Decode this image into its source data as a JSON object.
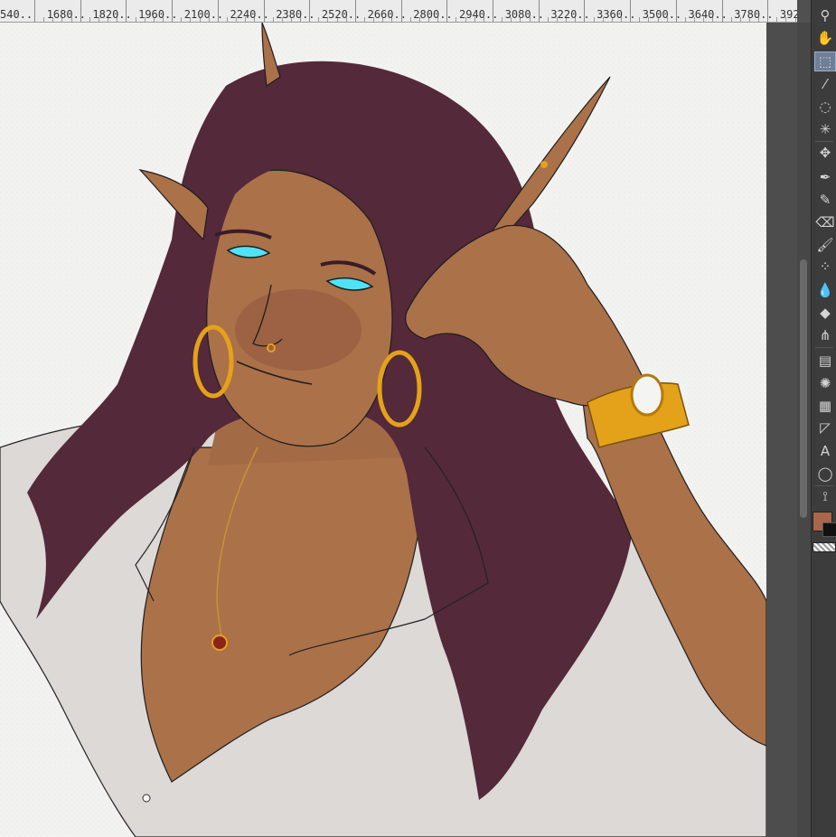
{
  "ruler": {
    "ticks": [
      "540",
      "1680",
      "1820",
      "1960",
      "2100",
      "2240",
      "2380",
      "2520",
      "2660",
      "2800",
      "2940",
      "3080",
      "3220",
      "3360",
      "3500",
      "3640",
      "3780",
      "392"
    ]
  },
  "tools": [
    {
      "name": "zoom-tool",
      "icon": "magnifier-icon",
      "glyph": "⚲"
    },
    {
      "name": "move-hand-tool",
      "icon": "hand-icon",
      "glyph": "✋"
    },
    {
      "name": "operation-tool",
      "icon": "object-select-icon",
      "glyph": "⬚",
      "active": true
    },
    {
      "name": "eyedropper-tool",
      "icon": "eyedropper-icon",
      "glyph": "⁄"
    },
    {
      "name": "lasso-tool",
      "icon": "lasso-icon",
      "glyph": "◌"
    },
    {
      "name": "magic-wand-tool",
      "icon": "magic-wand-icon",
      "glyph": "✳"
    },
    {
      "name": "move-layer-tool",
      "icon": "move-arrows-icon",
      "glyph": "✥"
    },
    {
      "name": "pen-tool",
      "icon": "pen-nib-icon",
      "glyph": "✒"
    },
    {
      "name": "pencil-tool",
      "icon": "pencil-icon",
      "glyph": "✎"
    },
    {
      "name": "eraser-tool",
      "icon": "eraser-icon",
      "glyph": "⌫"
    },
    {
      "name": "brush-tool",
      "icon": "brush-icon",
      "glyph": "🖌"
    },
    {
      "name": "airbrush-tool",
      "icon": "airbrush-icon",
      "glyph": "⁘"
    },
    {
      "name": "blend-tool",
      "icon": "blend-drops-icon",
      "glyph": "💧"
    },
    {
      "name": "fill-tool",
      "icon": "paint-bucket-icon",
      "glyph": "◆"
    },
    {
      "name": "decoration-tool",
      "icon": "grass-brush-icon",
      "glyph": "⋔"
    },
    {
      "name": "gradient-tool",
      "icon": "gradient-icon",
      "glyph": "▤"
    },
    {
      "name": "figure-tool",
      "icon": "concentric-lines-icon",
      "glyph": "✺"
    },
    {
      "name": "frame-border-tool",
      "icon": "frame-border-icon",
      "glyph": "▦"
    },
    {
      "name": "ruler-tool",
      "icon": "ruler-triangle-icon",
      "glyph": "◸"
    },
    {
      "name": "text-tool",
      "icon": "text-icon",
      "glyph": "A"
    },
    {
      "name": "balloon-tool",
      "icon": "speech-balloon-icon",
      "glyph": "◯"
    },
    {
      "name": "correct-line-tool",
      "icon": "correct-line-icon",
      "glyph": "⟟"
    }
  ],
  "colors": {
    "main_color": "#a8674a",
    "sub_color": "#111111",
    "canvas_paper": "#f2f2f0",
    "hair": "#54293a",
    "skin": "#ab7149",
    "shirt": "#dcd9d6",
    "eyes": "#4fe3f6",
    "gold": "#e4a21a"
  }
}
